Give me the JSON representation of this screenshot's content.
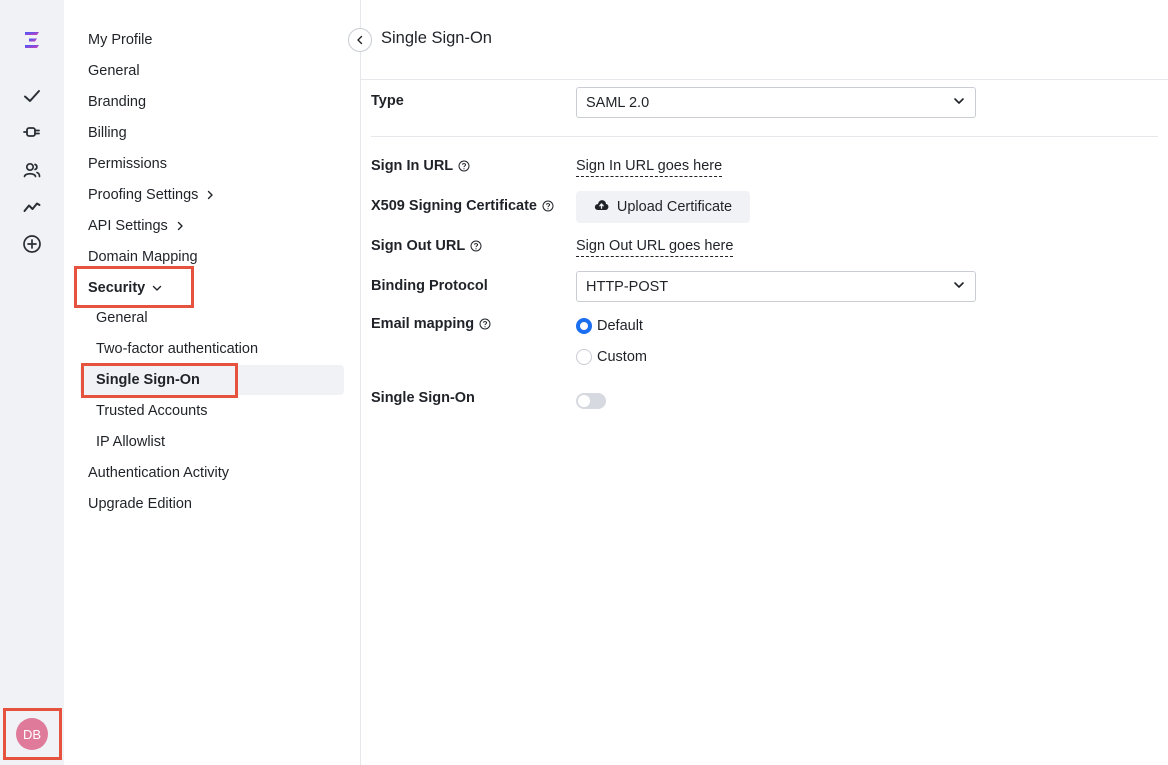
{
  "rail": {
    "logo_icon": "app-logo",
    "icons": [
      "checkmark-icon",
      "plug-icon",
      "users-icon",
      "activity-icon",
      "plus-circle-icon"
    ],
    "avatar_initials": "DB",
    "avatar_color": "#e07a9b"
  },
  "nav": {
    "my_profile": "My Profile",
    "general": "General",
    "branding": "Branding",
    "billing": "Billing",
    "permissions": "Permissions",
    "proofing_settings": "Proofing Settings",
    "api_settings": "API Settings",
    "domain_mapping": "Domain Mapping",
    "security": "Security",
    "security_items": {
      "general": "General",
      "two_factor": "Two-factor authentication",
      "sso": "Single Sign-On",
      "trusted_accounts": "Trusted Accounts",
      "ip_allowlist": "IP Allowlist"
    },
    "authentication_activity": "Authentication Activity",
    "upgrade_edition": "Upgrade Edition"
  },
  "header": {
    "title": "Single Sign-On"
  },
  "form": {
    "type_label": "Type",
    "type_value": "SAML 2.0",
    "sign_in_url_label": "Sign In URL",
    "sign_in_url_value": "Sign In URL goes here",
    "cert_label": "X509 Signing Certificate",
    "upload_label": "Upload Certificate",
    "sign_out_url_label": "Sign Out URL",
    "sign_out_url_value": "Sign Out URL goes here",
    "binding_label": "Binding Protocol",
    "binding_value": "HTTP-POST",
    "email_mapping_label": "Email mapping",
    "email_options": [
      "Default",
      "Custom"
    ],
    "email_selected": "Default",
    "sso_toggle_label": "Single Sign-On",
    "sso_enabled": false
  },
  "colors": {
    "highlight": "#e5533f",
    "accent": "#1a6ff0",
    "rail_bg": "#f1f2f6"
  }
}
